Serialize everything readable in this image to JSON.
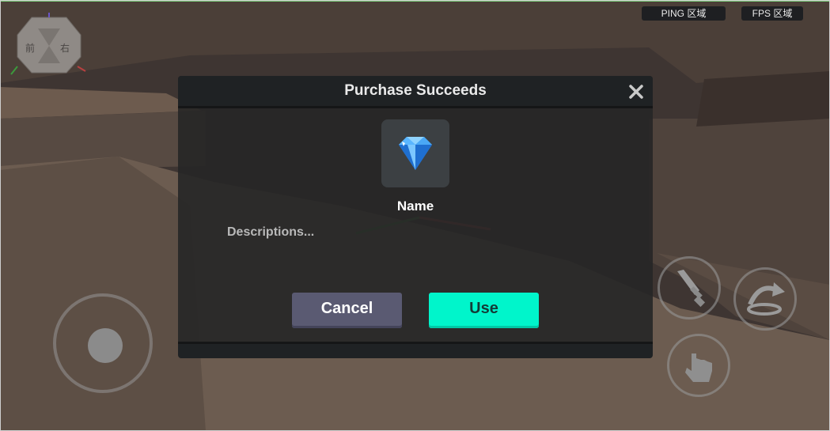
{
  "hud": {
    "ping_label": "PING 区域",
    "fps_label": "FPS 区域",
    "gizmo_front": "前",
    "gizmo_right": "右"
  },
  "dialog": {
    "title": "Purchase Succeeds",
    "item_name": "Name",
    "item_description": "Descriptions...",
    "item_icon": "diamond-icon",
    "cancel_label": "Cancel",
    "use_label": "Use"
  },
  "controls": {
    "joystick": "joystick",
    "actions": [
      "attack-sword-icon",
      "jump-icon",
      "grab-hand-icon"
    ]
  },
  "colors": {
    "use_button": "#00f5cb",
    "cancel_button": "#5a5a72",
    "dialog_bg": "#262626",
    "header_bg": "#1f2224"
  }
}
